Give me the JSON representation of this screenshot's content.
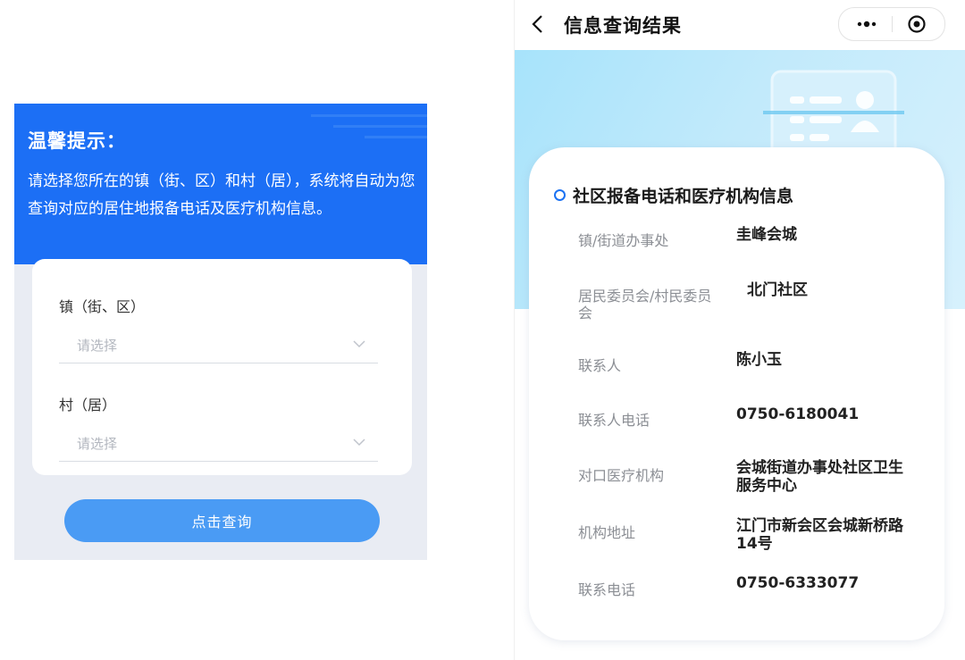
{
  "left": {
    "tip_title": "温馨提示：",
    "tip_body": "请选择您所在的镇（街、区）和村（居），系统将自动为您查询对应的居住地报备电话及医疗机构信息。",
    "town_label": "镇（街、区）",
    "town_placeholder": "请选择",
    "village_label": "村（居）",
    "village_placeholder": "请选择",
    "query_button": "点击查询",
    "colors": {
      "banner": "#1c6ff5",
      "button": "#4a9bf4"
    }
  },
  "right": {
    "nav_title": "信息查询结果",
    "section_title": "社区报备电话和医疗机构信息",
    "rows": [
      {
        "label": "镇/街道办事处",
        "value": "圭峰会城"
      },
      {
        "label": "居民委员会/村民委员会",
        "value": "北门社区"
      },
      {
        "label": "联系人",
        "value": "陈小玉"
      },
      {
        "label": "联系人电话",
        "value": "0750-6180041"
      },
      {
        "label": "对口医疗机构",
        "value": "会城街道办事处社区卫生服务中心"
      },
      {
        "label": "机构地址",
        "value": "江门市新会区会城新桥路14号"
      },
      {
        "label": "联系电话",
        "value": "0750-6333077"
      }
    ],
    "colors": {
      "accent": "#1c72f2"
    }
  }
}
